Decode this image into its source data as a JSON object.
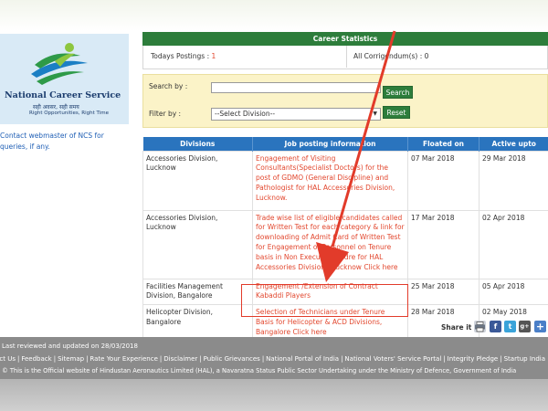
{
  "logo": {
    "title": "National Career Service",
    "hindi": "सही अवसर, सही समय",
    "tagline": "Right Opportunities, Right Time"
  },
  "contact_link": "Contact webmaster of NCS for queries, if any.",
  "stats": {
    "header": "Career Statistics",
    "todays_label": "Todays Postings : ",
    "todays_value": "1",
    "corrigendum_label": "All Corrigendum(s) : 0"
  },
  "search": {
    "search_label": "Search by :",
    "search_value": "",
    "search_button": "Search",
    "filter_label": "Filter by :",
    "filter_selected": "--Select Division--",
    "reset_button": "Reset"
  },
  "table": {
    "headers": [
      "Divisions",
      "Job posting information",
      "Floated on",
      "Active upto"
    ],
    "rows": [
      {
        "division": "Accessories Division, Lucknow",
        "info": "Engagement of Visiting Consultants(Specialist Doctors) for the post of GDMO (General Discipline) and Pathologist for HAL Accessories Division, Lucknow.",
        "floated": "07 Mar 2018",
        "active": "29 Mar 2018"
      },
      {
        "division": "Accessories Division, Lucknow",
        "info": "Trade wise list of eligible candidates called for Written Test for each category & link for downloading of Admit Card of Written Test for Engagement of Personnel on Tenure basis in Non Executive Cadre for HAL Accessories Division , Lucknow Click here",
        "floated": "17 Mar 2018",
        "active": "02 Apr 2018"
      },
      {
        "division": "Facilities Management Division, Bangalore",
        "info": "Engagement /Extension of Contract Kabaddi Players",
        "floated": "25 Mar 2018",
        "active": "05 Apr 2018"
      },
      {
        "division": "Helicopter Division, Bangalore",
        "info": "Selection of Technicians under Tenure Basis for Helicopter & ACD Divisions, Bangalore Click here",
        "floated": "28 Mar 2018",
        "active": "02 May 2018"
      }
    ]
  },
  "share": {
    "label": "Share it :",
    "icons": [
      "print-icon",
      "facebook-icon",
      "twitter-icon",
      "google-plus-icon",
      "addthis-icon"
    ],
    "facebook_glyph": "f",
    "twitter_glyph": "t",
    "gplus_glyph": "g+",
    "addthis_glyph": "+"
  },
  "footer": {
    "last_reviewed": "Last reviewed and updated on 28/03/2018",
    "links": [
      "Contact Us",
      "Feedback",
      "Sitemap",
      "Rate Your Experience",
      "Disclaimer",
      "Public Grievances",
      "National Portal of India",
      "National Voters' Service Portal",
      "Integrity Pledge",
      "Startup India"
    ],
    "official": "© This is the Official website of Hindustan Aeronautics Limited (HAL), a Navaratna Status Public Sector Undertaking under the Ministry of Defence, Government of India"
  },
  "colors": {
    "green": "#2d7d3b",
    "blue_header": "#2a74be",
    "link_red": "#e2472e",
    "annotation_red": "#e23b2a",
    "footer_grey": "#8b8b8b"
  }
}
